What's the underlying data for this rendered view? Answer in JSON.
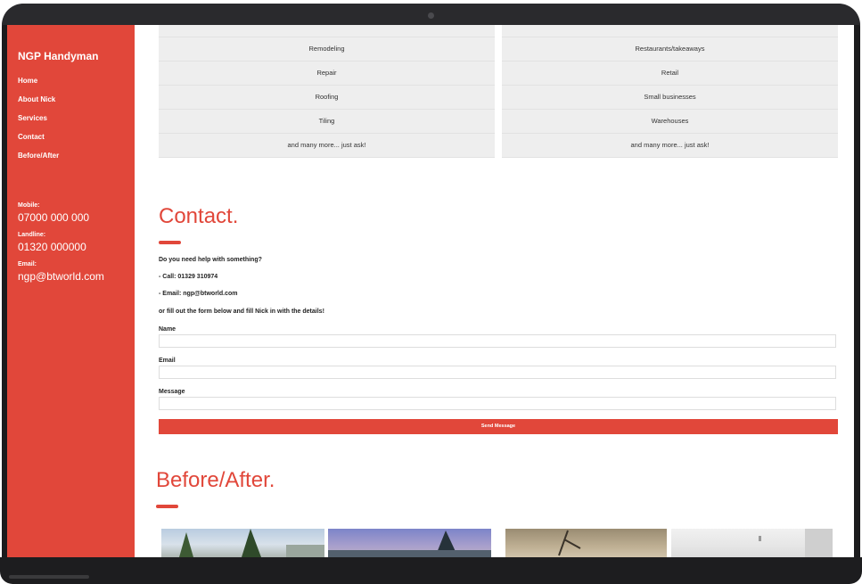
{
  "sidebar": {
    "brand": "NGP Handyman",
    "nav": [
      "Home",
      "About Nick",
      "Services",
      "Contact",
      "Before/After"
    ],
    "mobile_label": "Mobile:",
    "mobile_value": "07000 000 000",
    "landline_label": "Landline:",
    "landline_value": "01320 000000",
    "email_label": "Email:",
    "email_value": "ngp@btworld.com"
  },
  "services": {
    "left": [
      "Remodeling",
      "Repair",
      "Roofing",
      "Tiling",
      "and many more... just ask!"
    ],
    "right": [
      "Restaurants/takeaways",
      "Retail",
      "Small businesses",
      "Warehouses",
      "and many more... just ask!"
    ]
  },
  "contact": {
    "title": "Contact.",
    "intro": "Do you need help with something?",
    "call": "- Call: 01329 310974",
    "email": "- Email: ngp@btworld.com",
    "fill": "or fill out the form below and fill Nick in with the details!",
    "name_label": "Name",
    "email_label": "Email",
    "message_label": "Message",
    "send_label": "Send Message"
  },
  "before_after": {
    "title": "Before/After."
  },
  "colors": {
    "accent": "#e1473a",
    "cell_bg": "#eeeeee"
  }
}
